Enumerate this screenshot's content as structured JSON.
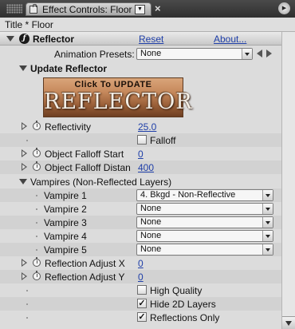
{
  "tab": {
    "title": "Effect Controls: Floor",
    "menu_glyph": "▼",
    "close_glyph": "×",
    "panel_menu_glyph": "▶"
  },
  "comp_title": "Title * Floor",
  "effect": {
    "name": "Reflector",
    "reset_label": "Reset",
    "about_label": "About...",
    "fx_glyph": "ƒ",
    "presets_label": "Animation Presets:",
    "presets_value": "None"
  },
  "update_group": {
    "label": "Update Reflector",
    "button_top": "Click To UPDATE",
    "button_big": "REFLECTOR"
  },
  "params": {
    "reflectivity": {
      "label": "Reflectivity",
      "value": "25.0"
    },
    "falloff": {
      "label": "Falloff",
      "checked": false
    },
    "object_falloff_start": {
      "label": "Object Falloff Start",
      "value": "0"
    },
    "object_falloff_distance": {
      "label": "Object Falloff Distan",
      "value": "400"
    }
  },
  "vampires": {
    "label": "Vampires (Non-Reflected Layers)",
    "items": [
      {
        "label": "Vampire 1",
        "value": "4. Bkgd - Non-Reflective"
      },
      {
        "label": "Vampire 2",
        "value": "None"
      },
      {
        "label": "Vampire 3",
        "value": "None"
      },
      {
        "label": "Vampire 4",
        "value": "None"
      },
      {
        "label": "Vampire 5",
        "value": "None"
      }
    ]
  },
  "adjust": {
    "x": {
      "label": "Reflection Adjust X",
      "value": "0"
    },
    "y": {
      "label": "Reflection Adjust Y",
      "value": "0"
    }
  },
  "checkboxes": {
    "high_quality": {
      "label": "High Quality",
      "checked": false,
      "mark": ""
    },
    "hide_2d": {
      "label": "Hide 2D Layers",
      "checked": true,
      "mark": "✓"
    },
    "reflections_only": {
      "label": "Reflections Only",
      "checked": true,
      "mark": "✓"
    }
  }
}
